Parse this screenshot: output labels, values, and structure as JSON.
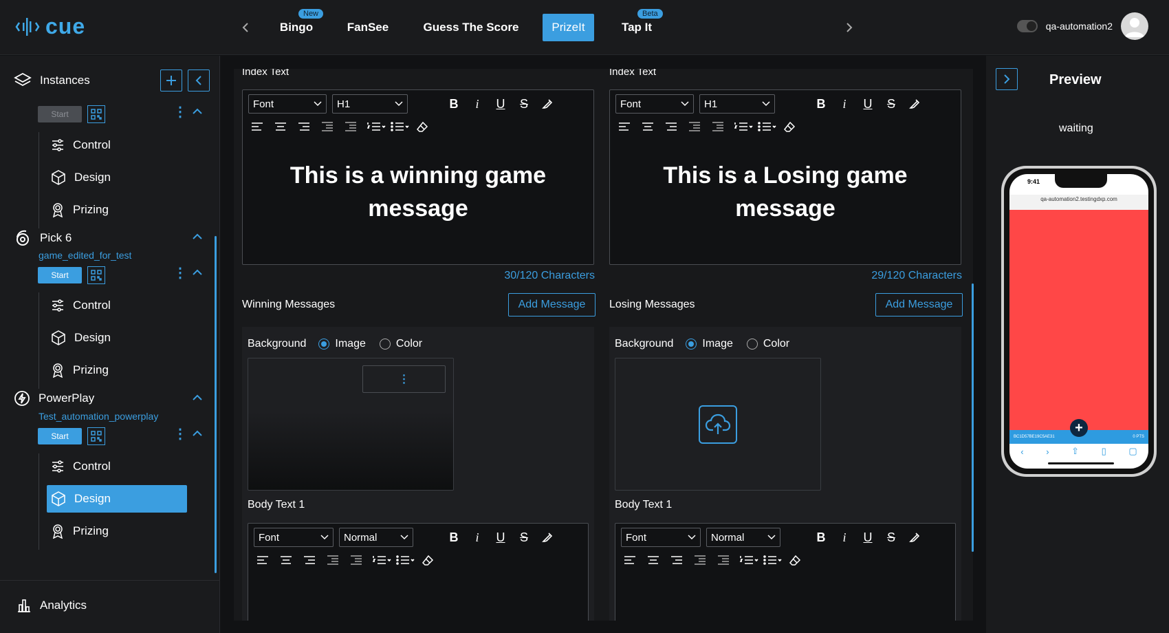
{
  "app": {
    "logo_text": "cue"
  },
  "nav": {
    "tabs": [
      {
        "label": "Bingo",
        "badge": "New"
      },
      {
        "label": "FanSee"
      },
      {
        "label": "Guess The Score"
      },
      {
        "label": "PrizeIt",
        "active": true
      },
      {
        "label": "Tap It",
        "badge": "Beta"
      }
    ]
  },
  "user": {
    "name": "qa-automation2"
  },
  "sidebar": {
    "title": "Instances",
    "instances": [
      {
        "name": "",
        "subtitle": "",
        "start_label": "Start",
        "start_enabled": false,
        "items": [
          "Control",
          "Design",
          "Prizing"
        ]
      },
      {
        "name": "Pick 6",
        "subtitle": "game_edited_for_test",
        "start_label": "Start",
        "start_enabled": true,
        "items": [
          "Control",
          "Design",
          "Prizing"
        ]
      },
      {
        "name": "PowerPlay",
        "subtitle": "Test_automation_powerplay",
        "start_label": "Start",
        "start_enabled": true,
        "items": [
          "Control",
          "Design",
          "Prizing"
        ],
        "active_item": "Design"
      }
    ],
    "analytics_label": "Analytics"
  },
  "winning": {
    "index_label": "Index Text",
    "font_select": "Font",
    "heading_select": "H1",
    "message": "This is a winning game message",
    "counter": "30/120 Characters",
    "section_label": "Winning Messages",
    "add_label": "Add Message",
    "background_label": "Background",
    "image_option": "Image",
    "color_option": "Color",
    "body_label": "Body Text 1",
    "body_font": "Font",
    "body_style": "Normal"
  },
  "losing": {
    "index_label": "Index Text",
    "font_select": "Font",
    "heading_select": "H1",
    "message": "This is a Losing game message",
    "counter": "29/120 Characters",
    "section_label": "Losing Messages",
    "add_label": "Add Message",
    "background_label": "Background",
    "image_option": "Image",
    "color_option": "Color",
    "body_label": "Body Text 1",
    "body_font": "Font",
    "body_style": "Normal"
  },
  "preview": {
    "title": "Preview",
    "status": "waiting",
    "phone_time": "9:41",
    "phone_url": "qa-automation2.testingdxp.com",
    "phone_bar_left": "BC1D57BE19C5AE31",
    "phone_bar_right": "0 PTS",
    "screen_color": "#ff4747"
  },
  "colors": {
    "accent": "#3b9ee0",
    "background": "#111214",
    "panel": "#1a1b1d"
  }
}
